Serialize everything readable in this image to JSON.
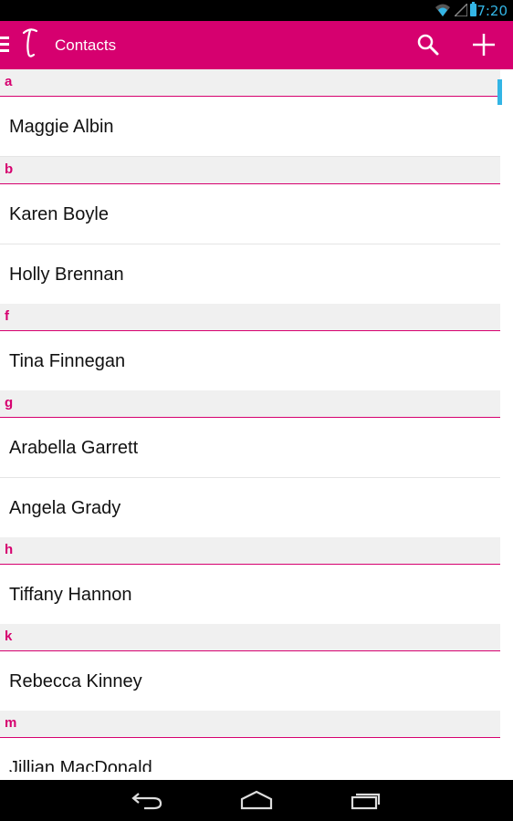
{
  "status_bar": {
    "time": "7:20"
  },
  "app_bar": {
    "title": "Contacts",
    "logo_icon": "script-t-logo",
    "drawer_icon": "hamburger-icon",
    "search_icon": "search-icon",
    "add_icon": "plus-icon",
    "color": "#d6006f"
  },
  "sections": [
    {
      "letter": "a",
      "contacts": [
        "Maggie Albin"
      ]
    },
    {
      "letter": "b",
      "contacts": [
        "Karen Boyle",
        "Holly Brennan"
      ]
    },
    {
      "letter": "f",
      "contacts": [
        "Tina Finnegan"
      ]
    },
    {
      "letter": "g",
      "contacts": [
        "Arabella Garrett",
        "Angela Grady"
      ]
    },
    {
      "letter": "h",
      "contacts": [
        "Tiffany Hannon"
      ]
    },
    {
      "letter": "k",
      "contacts": [
        "Rebecca Kinney"
      ]
    },
    {
      "letter": "m",
      "contacts": [
        "Jillian MacDonald"
      ]
    }
  ],
  "accent_color": "#33b5e5",
  "nav_bar": {
    "back_icon": "back-icon",
    "home_icon": "home-icon",
    "recents_icon": "recents-icon"
  }
}
